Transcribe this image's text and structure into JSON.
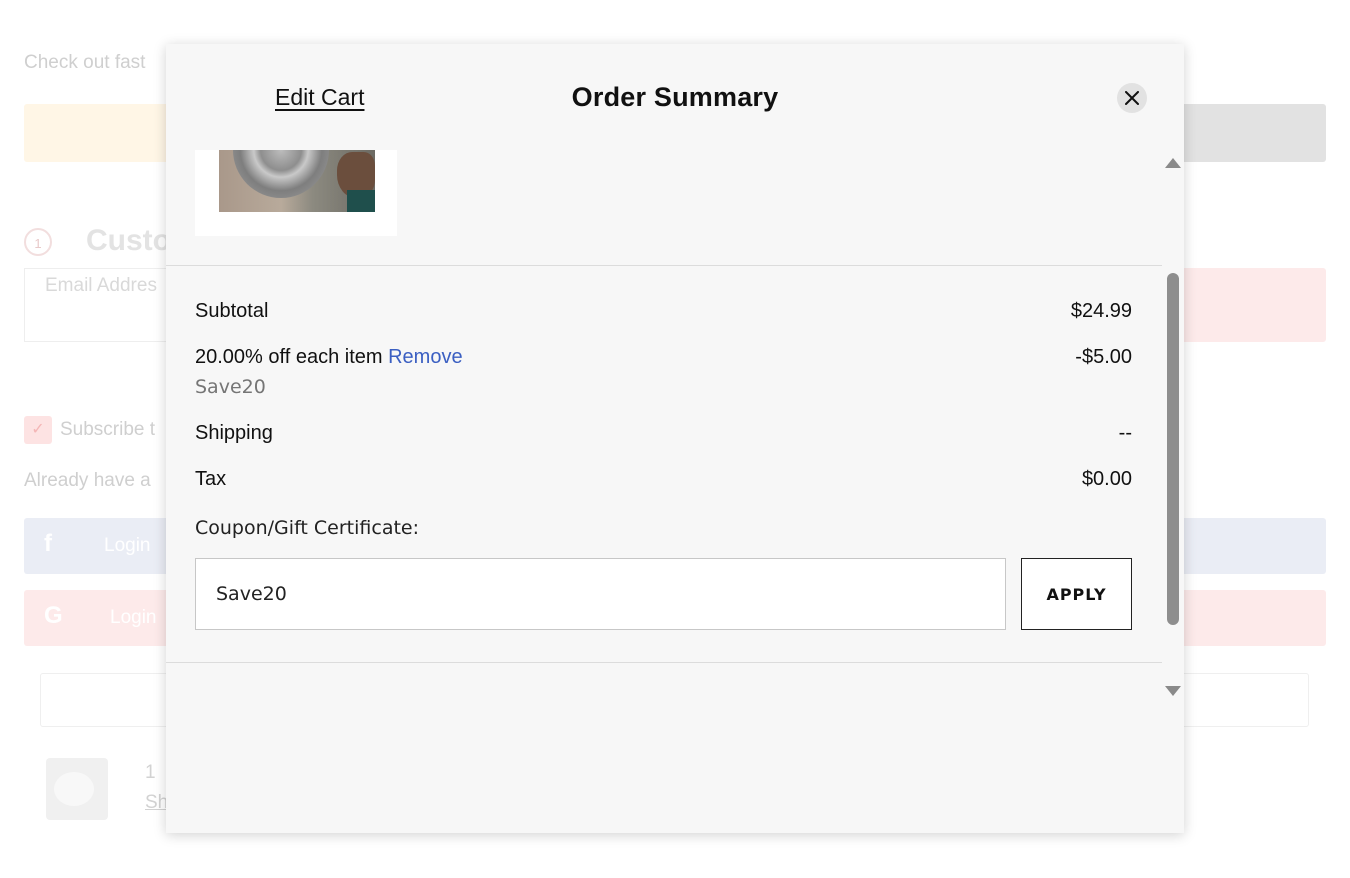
{
  "background": {
    "checkout_intro": "Check out fast",
    "step_number": "1",
    "section_heading": "Custo",
    "email_placeholder": "Email Addres",
    "subscribe_label": "Subscribe t",
    "already_account": "Already have a",
    "login_facebook": "Login",
    "login_google": "Login",
    "item_qty": "1",
    "item_link": "Sh",
    "colors": {
      "paypal_yellow": "#fff6e6",
      "facebook_blue": "#eaedf5",
      "google_red": "#fdeaea",
      "error_pink": "#fdeaea",
      "gray_button": "#e2e2e2"
    }
  },
  "modal": {
    "edit_cart_label": "Edit Cart",
    "title": "Order Summary",
    "close_icon": "close-icon"
  },
  "summary": {
    "subtotal_label": "Subtotal",
    "subtotal_value": "$24.99",
    "discount_label": "20.00% off each item",
    "remove_label": "Remove",
    "discount_value": "-$5.00",
    "discount_code": "Save20",
    "shipping_label": "Shipping",
    "shipping_value": "--",
    "tax_label": "Tax",
    "tax_value": "$0.00"
  },
  "coupon": {
    "label": "Coupon/Gift Certificate:",
    "input_value": "Save20",
    "apply_label": "APPLY"
  },
  "colors": {
    "link_blue": "#3b5fc2",
    "modal_bg": "#f7f7f7"
  }
}
